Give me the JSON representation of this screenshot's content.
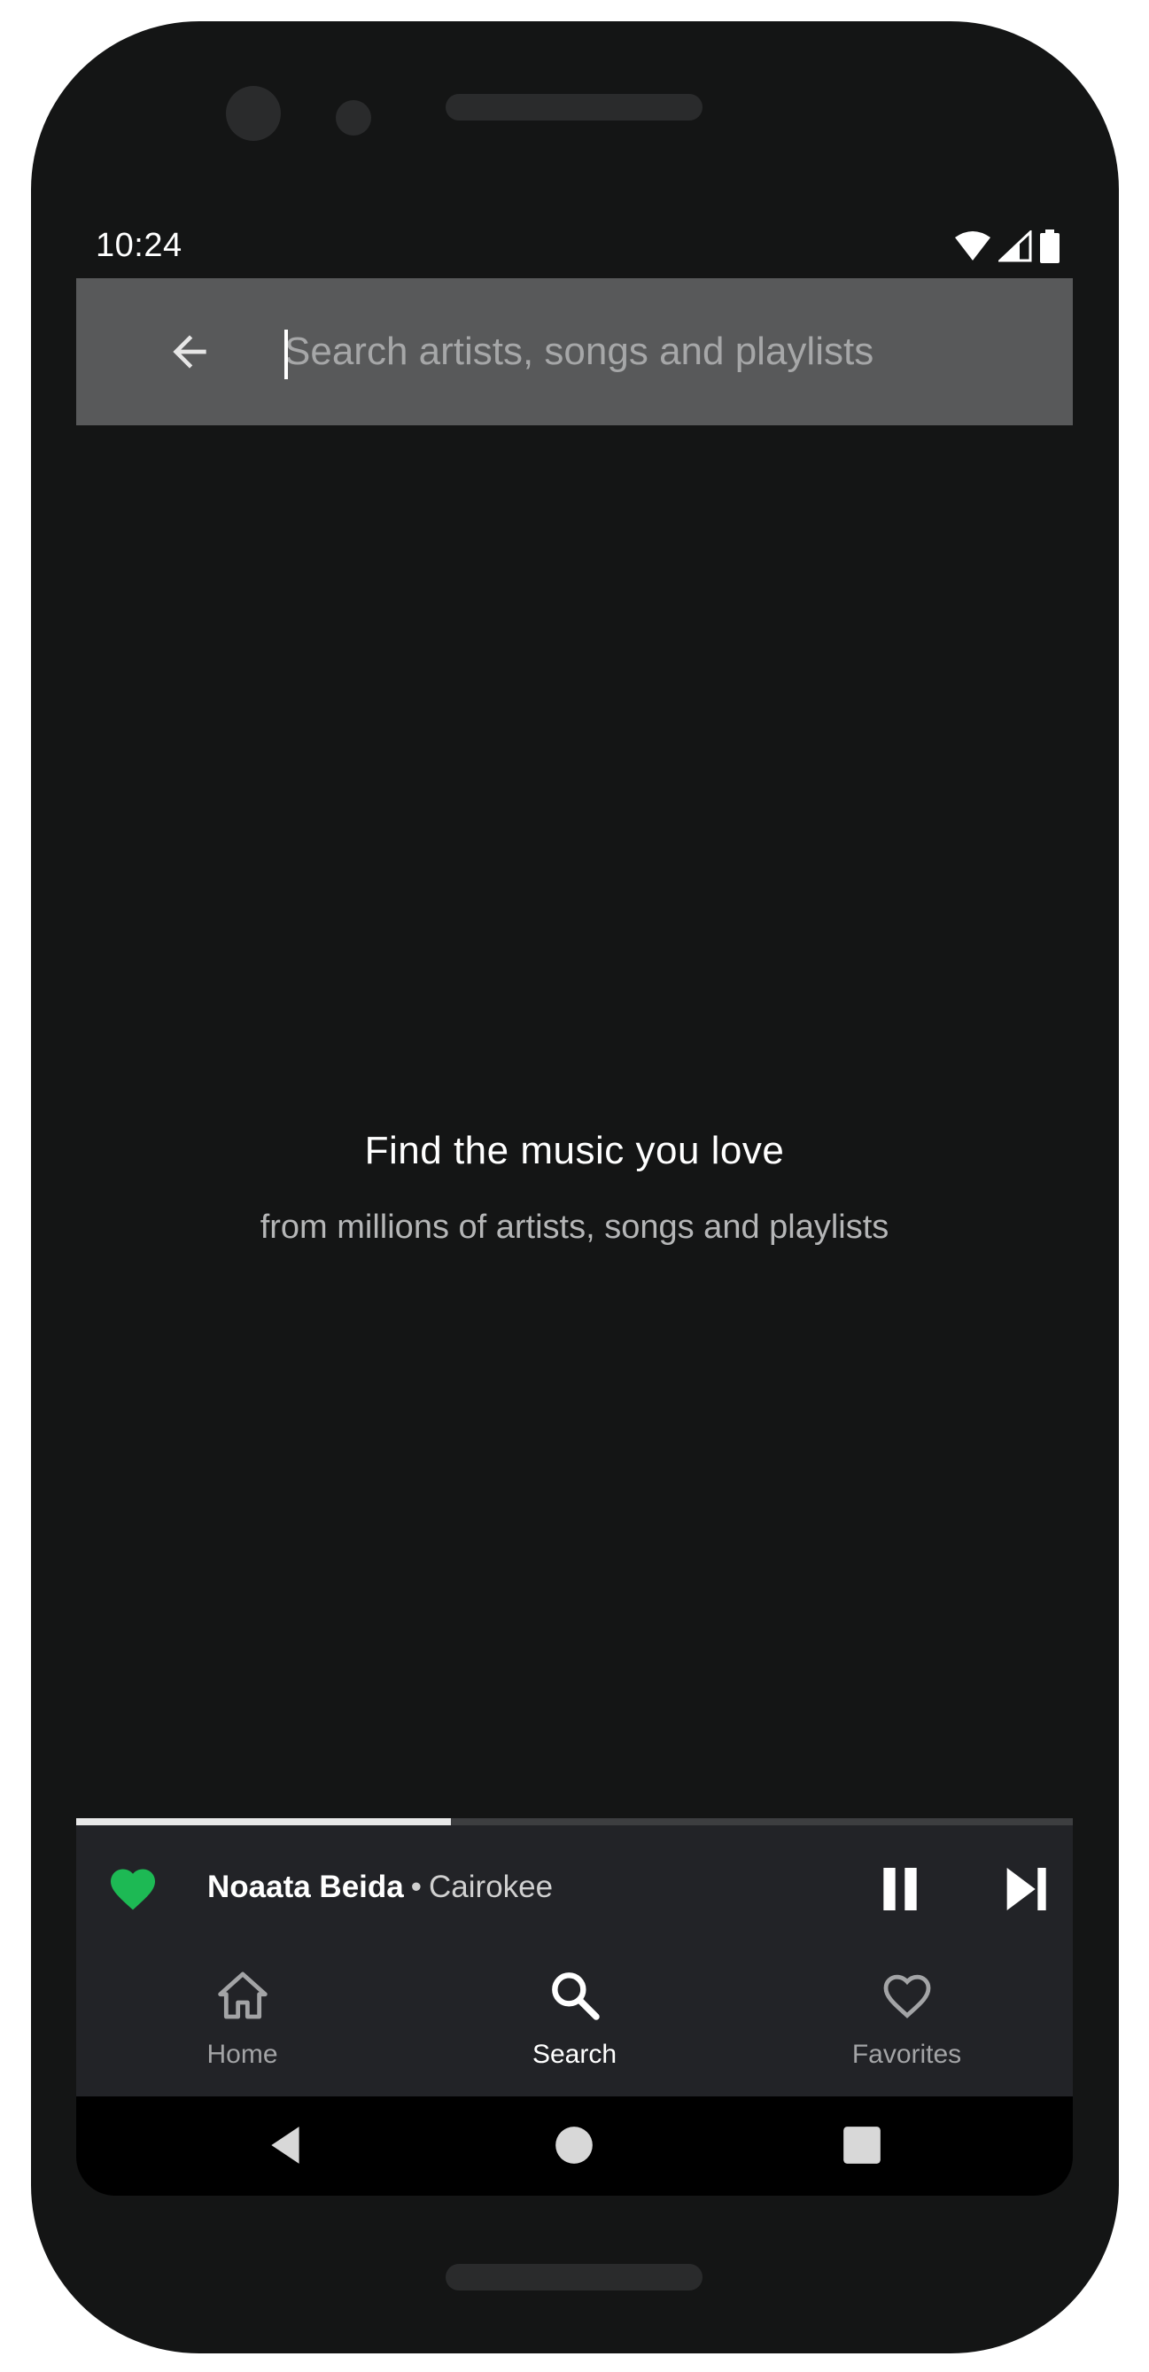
{
  "status_bar": {
    "time": "10:24"
  },
  "search": {
    "placeholder": "Search artists, songs and playlists",
    "value": ""
  },
  "empty_state": {
    "title": "Find the music you love",
    "subtitle": "from millions of artists, songs and playlists"
  },
  "now_playing": {
    "title": "Noaata Beida",
    "separator": "•",
    "artist": "Cairokee",
    "progress": 0.376,
    "liked": true
  },
  "bottom_nav": {
    "items": [
      {
        "label": "Home",
        "icon": "home-icon",
        "active": false
      },
      {
        "label": "Search",
        "icon": "search-icon",
        "active": true
      },
      {
        "label": "Favorites",
        "icon": "heart-outline-icon",
        "active": false
      }
    ]
  },
  "colors": {
    "background": "#141515",
    "search_bar": "#58595a",
    "player_bg": "#222327",
    "accent_green": "#1db954",
    "inactive_text": "#a3a4a6"
  }
}
